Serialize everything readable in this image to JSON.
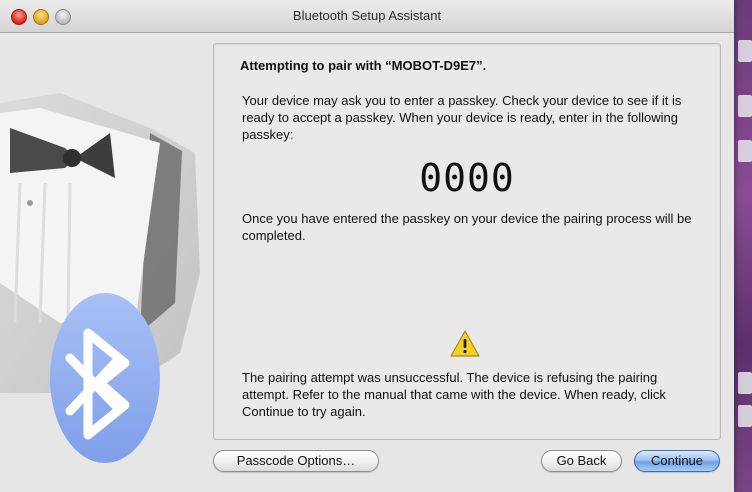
{
  "window": {
    "title": "Bluetooth Setup Assistant"
  },
  "panel": {
    "heading": "Attempting to pair with “MOBOT-D9E7”.",
    "instructions": "Your device may ask you to enter a passkey. Check your device to see if it is ready to accept a passkey. When your device is ready, enter in the following passkey:",
    "passkey": "0000",
    "completion_text": "Once you have entered the passkey on your device the pairing process will be completed.",
    "error_text": "The pairing attempt was unsuccessful. The device is refusing the pairing attempt. Refer to the manual that came with the device. When ready, click Continue to try again."
  },
  "buttons": {
    "passcode_options": "Passcode Options…",
    "go_back": "Go Back",
    "continue": "Continue"
  },
  "colors": {
    "accent_blue": "#6ea3e2",
    "bluetooth_badge": "#8aa9f0",
    "warning_yellow": "#f2d02a"
  },
  "icons": {
    "warning": "warning-triangle-icon",
    "art": "bluetooth-tuxedo-artwork"
  }
}
